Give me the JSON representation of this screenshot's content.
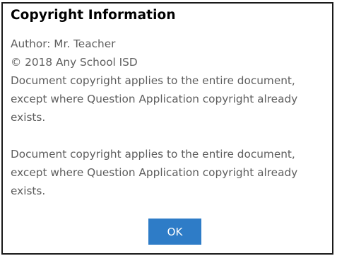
{
  "dialog": {
    "title": "Copyright Information",
    "author": "Author: Mr. Teacher",
    "copyright": "© 2018 Any School ISD",
    "document_notice": {
      "line1": "Document copyright applies to the entire document,",
      "line2": "except where Question Application copyright already",
      "line3": "exists."
    },
    "question_notice": {
      "line1": "Document copyright applies to the entire document,",
      "line2": "except where Question Application copyright already",
      "line3": "exists."
    },
    "ok_label": "OK"
  },
  "colors": {
    "ok_button_bg": "#2e7cc7",
    "body_text": "#5e5e5e",
    "border": "#1a1a1a"
  }
}
